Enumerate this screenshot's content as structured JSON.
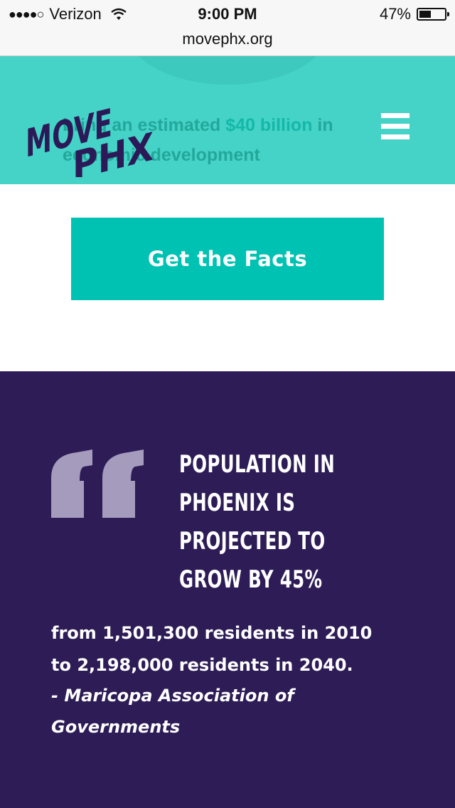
{
  "status_bar": {
    "signal_dots": "●●●●○",
    "carrier": "Verizon",
    "time": "9:00 PM",
    "battery_percent": "47%",
    "battery_level": 0.47
  },
  "browser": {
    "url": "movephx.org"
  },
  "header": {
    "logo_line1": "MOVE",
    "logo_line2": "PHX",
    "hero_before": "bring an estimated ",
    "hero_highlight": "$40 billion",
    "hero_after": " in economic development",
    "menu_icon": "hamburger-menu-icon"
  },
  "cta": {
    "label": "Get the Facts"
  },
  "quote_section": {
    "quote_icon": "quotation-mark-icon",
    "headline_lines": [
      "POPULATION IN",
      "PHOENIX IS",
      "PROJECTED TO",
      "GROW BY 45%"
    ],
    "body_line1": "from 1,501,300 residents in 2010",
    "body_line2": "to 2,198,000 residents in 2040.",
    "attribution": "- Maricopa Association of Governments"
  },
  "colors": {
    "teal_header": "#45d3c7",
    "cta_teal": "#00c2b2",
    "purple": "#2e1c57",
    "logo_purple": "#2b1a57",
    "quote_mark": "#a59bbd"
  }
}
